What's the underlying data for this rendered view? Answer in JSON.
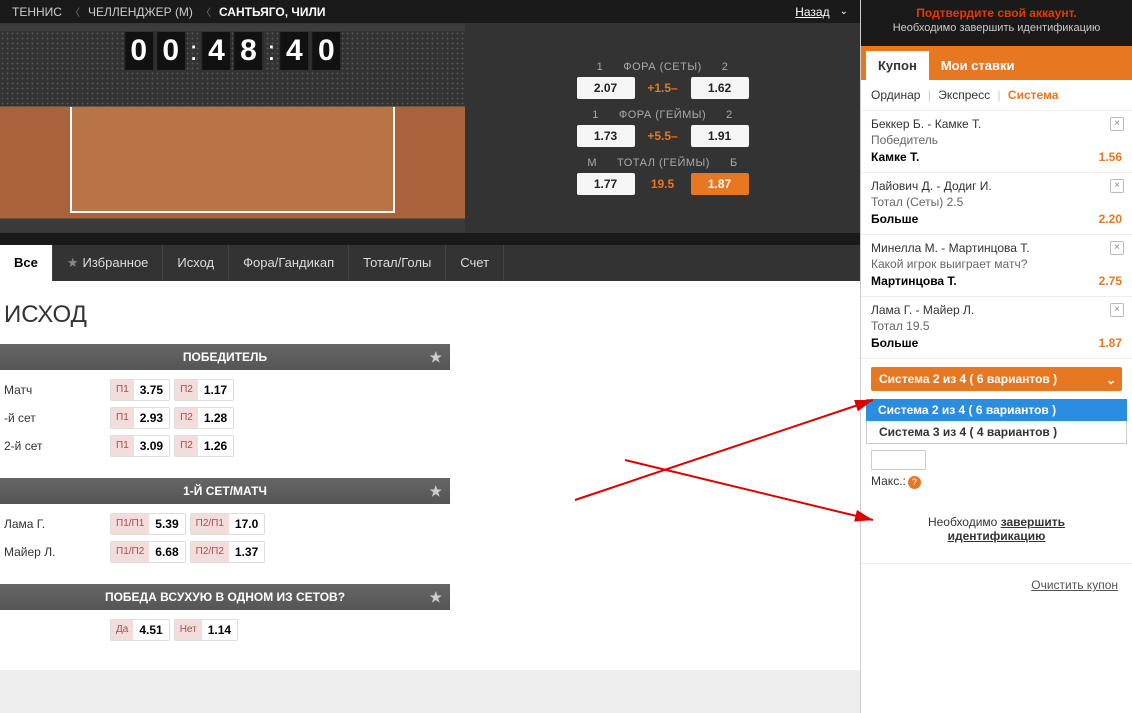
{
  "breadcrumb": {
    "items": [
      "ТЕННИС",
      "ЧЕЛЛЕНДЖЕР (М)",
      "САНТЬЯГО, ЧИЛИ"
    ],
    "back": "Назад"
  },
  "timer": {
    "d1": "0",
    "d2": "0",
    "d3": "4",
    "d4": "8",
    "d5": "4",
    "d6": "0"
  },
  "live_odds": {
    "r1": {
      "title": "ФОРА (СЕТЫ)",
      "h1": "1",
      "h2": "2",
      "o1": "2.07",
      "mid": "+1.5–",
      "o2": "1.62"
    },
    "r2": {
      "title": "ФОРА (ГЕЙМЫ)",
      "h1": "1",
      "h2": "2",
      "o1": "1.73",
      "mid": "+5.5–",
      "o2": "1.91"
    },
    "r3": {
      "title": "ТОТАЛ (ГЕЙМЫ)",
      "h1": "М",
      "h2": "Б",
      "o1": "1.77",
      "mid": "19.5",
      "o2": "1.87"
    }
  },
  "tabs": {
    "t0": "Все",
    "t1": "Избранное",
    "t2": "Исход",
    "t3": "Фора/Гандикап",
    "t4": "Тотал/Голы",
    "t5": "Счет"
  },
  "section": "ИСХОД",
  "markets": {
    "m1": {
      "title": "ПОБЕДИТЕЛЬ",
      "rows": {
        "r0": {
          "label": "Матч",
          "p1t": "П1",
          "p1v": "3.75",
          "p2t": "П2",
          "p2v": "1.17"
        },
        "r1": {
          "label": "-й сет",
          "p1t": "П1",
          "p1v": "2.93",
          "p2t": "П2",
          "p2v": "1.28"
        },
        "r2": {
          "label": "2-й сет",
          "p1t": "П1",
          "p1v": "3.09",
          "p2t": "П2",
          "p2v": "1.26"
        }
      }
    },
    "m2": {
      "title": "1-Й СЕТ/МАТЧ",
      "rows": {
        "r0": {
          "label": "Лама Г.",
          "p1t": "П1/П1",
          "p1v": "5.39",
          "p2t": "П2/П1",
          "p2v": "17.0"
        },
        "r1": {
          "label": "Майер Л.",
          "p1t": "П1/П2",
          "p1v": "6.68",
          "p2t": "П2/П2",
          "p2v": "1.37"
        }
      }
    },
    "m3": {
      "title": "ПОБЕДА ВСУХУЮ В ОДНОМ ИЗ СЕТОВ?",
      "rows": {
        "r0": {
          "label": "",
          "p1t": "Да",
          "p1v": "4.51",
          "p2t": "Нет",
          "p2v": "1.14"
        }
      }
    }
  },
  "rp": {
    "verify": {
      "title": "Подтвердите свой аккаунт.",
      "text": "Необходимо завершить идентификацию"
    },
    "ctabs": {
      "t0": "Купон",
      "t1": "Мои ставки"
    },
    "bettypes": {
      "b0": "Ординар",
      "b1": "Экспресс",
      "b2": "Система"
    },
    "bets": {
      "b0": {
        "names": "Беккер Б. - Камке Т.",
        "market": "Победитель",
        "pick": "Камке Т.",
        "odds": "1.56"
      },
      "b1": {
        "names": "Лайович Д. - Додиг И.",
        "market": "Тотал (Сеты) 2.5",
        "pick": "Больше",
        "odds": "2.20"
      },
      "b2": {
        "names": "Минелла М. - Мартинцова Т.",
        "market": "Какой игрок выиграет матч?",
        "pick": "Мартинцова Т.",
        "odds": "2.75"
      },
      "b3": {
        "names": "Лама Г. - Майер Л.",
        "market": "Тотал 19.5",
        "pick": "Больше",
        "odds": "1.87"
      }
    },
    "system": {
      "selected": "Система 2 из 4 ( 6 вариантов )",
      "opt1": "Система 2 из 4 ( 6 вариантов )",
      "opt2": "Система 3 из 4 ( 4 вариантов )"
    },
    "stake": {
      "max_label": "Макс.:"
    },
    "verify_msg": {
      "pre": "Необходимо ",
      "link1": "завершить",
      "link2": "идентификацию"
    },
    "clear": "Очистить купон"
  }
}
